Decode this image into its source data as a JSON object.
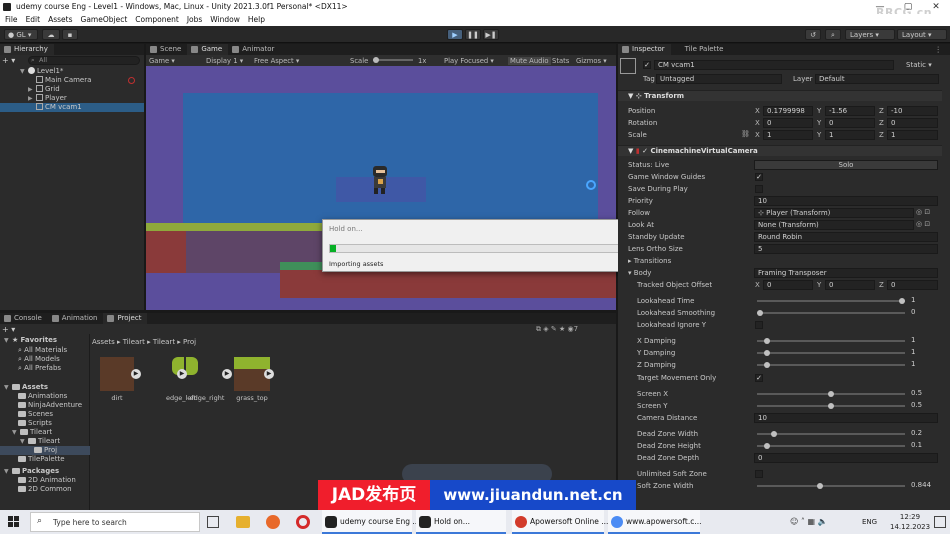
{
  "window": {
    "title": "udemy course Eng - Level1 - Windows, Mac, Linux - Unity 2021.3.0f1 Personal* <DX11>",
    "controls": [
      "—",
      "▢",
      "✕"
    ]
  },
  "watermark": "RRCG.cn",
  "menu": [
    "File",
    "Edit",
    "Assets",
    "GameObject",
    "Component",
    "Jobs",
    "Window",
    "Help"
  ],
  "toolbar": {
    "account": "GL",
    "layers": "Layers",
    "layout": "Layout"
  },
  "hierarchy": {
    "tab": "Hierarchy",
    "search_placeholder": "All",
    "items": [
      {
        "label": "Level1*",
        "depth": 0
      },
      {
        "label": "Main Camera",
        "depth": 1
      },
      {
        "label": "Grid",
        "depth": 1
      },
      {
        "label": "Player",
        "depth": 1
      },
      {
        "label": "CM vcam1",
        "depth": 1
      }
    ]
  },
  "center_tabs": [
    "Scene",
    "Game",
    "Animator"
  ],
  "game_toolbar": {
    "mode": "Game",
    "display": "Display 1",
    "aspect": "Free Aspect",
    "scale_label": "Scale",
    "scale_value": "1x",
    "play_focused": "Play Focused",
    "mute": "Mute Audio",
    "stats": "Stats",
    "gizmos": "Gizmos"
  },
  "dialog": {
    "title": "Hold on...",
    "message": "Importing assets",
    "progress": 0.02
  },
  "bottom_tabs": [
    "Console",
    "Animation",
    "Project"
  ],
  "project": {
    "favorites_label": "Favorites",
    "favorites": [
      "All Materials",
      "All Models",
      "All Prefabs"
    ],
    "assets_label": "Assets",
    "folders": [
      "Animations",
      "NinjaAdventure",
      "Scenes",
      "Scripts",
      "Tileart"
    ],
    "tileart_children": [
      "Tileart",
      "Proj"
    ],
    "other_folders": [
      "TilePalette"
    ],
    "packages_label": "Packages",
    "packages": [
      "2D Animation",
      "2D Common"
    ],
    "breadcrumb": [
      "Assets",
      "Tileart",
      "Tileart",
      "Proj"
    ],
    "count": "7",
    "items": [
      {
        "label": "dirt"
      },
      {
        "label": "edge_left"
      },
      {
        "label": "edge_right"
      },
      {
        "label": "grass_top"
      }
    ]
  },
  "inspector": {
    "tabs": [
      "Inspector",
      "Tile Palette"
    ],
    "object_name": "CM vcam1",
    "static_label": "Static",
    "tag_label": "Tag",
    "tag_value": "Untagged",
    "layer_label": "Layer",
    "layer_value": "Default",
    "transform": {
      "header": "Transform",
      "rows": [
        {
          "label": "Position",
          "x": "0.1799998",
          "y": "-1.56",
          "z": "-10"
        },
        {
          "label": "Rotation",
          "x": "0",
          "y": "0",
          "z": "0"
        },
        {
          "label": "Scale",
          "x": "1",
          "y": "1",
          "z": "1"
        }
      ]
    },
    "vcam": {
      "header": "CinemachineVirtualCamera",
      "status_label": "Status: Live",
      "solo": "Solo",
      "game_window_guides": "Game Window Guides",
      "save_during_play": "Save During Play",
      "priority_label": "Priority",
      "priority": "10",
      "follow_label": "Follow",
      "follow": "Player (Transform)",
      "look_at_label": "Look At",
      "look_at": "None (Transform)",
      "standby_label": "Standby Update",
      "standby": "Round Robin",
      "ortho_label": "Lens Ortho Size",
      "ortho": "5",
      "transitions": "Transitions",
      "body_label": "Body",
      "body": "Framing Transposer",
      "tracked_label": "Tracked Object Offset",
      "tracked": {
        "x": "0",
        "y": "0",
        "z": "0"
      },
      "lookahead_time_label": "Lookahead Time",
      "lookahead_time": "1",
      "lookahead_smoothing_label": "Lookahead Smoothing",
      "lookahead_smoothing": "0",
      "lookahead_ignore_label": "Lookahead Ignore Y",
      "xdamp_label": "X Damping",
      "xdamp": "1",
      "ydamp_label": "Y Damping",
      "ydamp": "1",
      "zdamp_label": "Z Damping",
      "zdamp": "1",
      "target_only_label": "Target Movement Only",
      "screenx_label": "Screen X",
      "screenx": "0.5",
      "screeny_label": "Screen Y",
      "screeny": "0.5",
      "cam_dist_label": "Camera Distance",
      "cam_dist": "10",
      "dz_width_label": "Dead Zone Width",
      "dz_width": "0.2",
      "dz_height_label": "Dead Zone Height",
      "dz_height": "0.1",
      "dz_depth_label": "Dead Zone Depth",
      "dz_depth": "0",
      "unlimited_label": "Unlimited Soft Zone",
      "soft_width_label": "Soft Zone Width",
      "soft_width": "0.844"
    }
  },
  "overlay_banner": {
    "brand": "JAD发布页",
    "url": "www.jiuandun.net.cn"
  },
  "taskbar": {
    "search_placeholder": "Type here to search",
    "windows": [
      {
        "label": "udemy course Eng ..."
      },
      {
        "label": "Hold on..."
      },
      {
        "label": "Apowersoft Online ..."
      },
      {
        "label": "www.apowersoft.c..."
      }
    ],
    "lang": "ENG",
    "time": "12:29",
    "date": "14.12.2023"
  }
}
